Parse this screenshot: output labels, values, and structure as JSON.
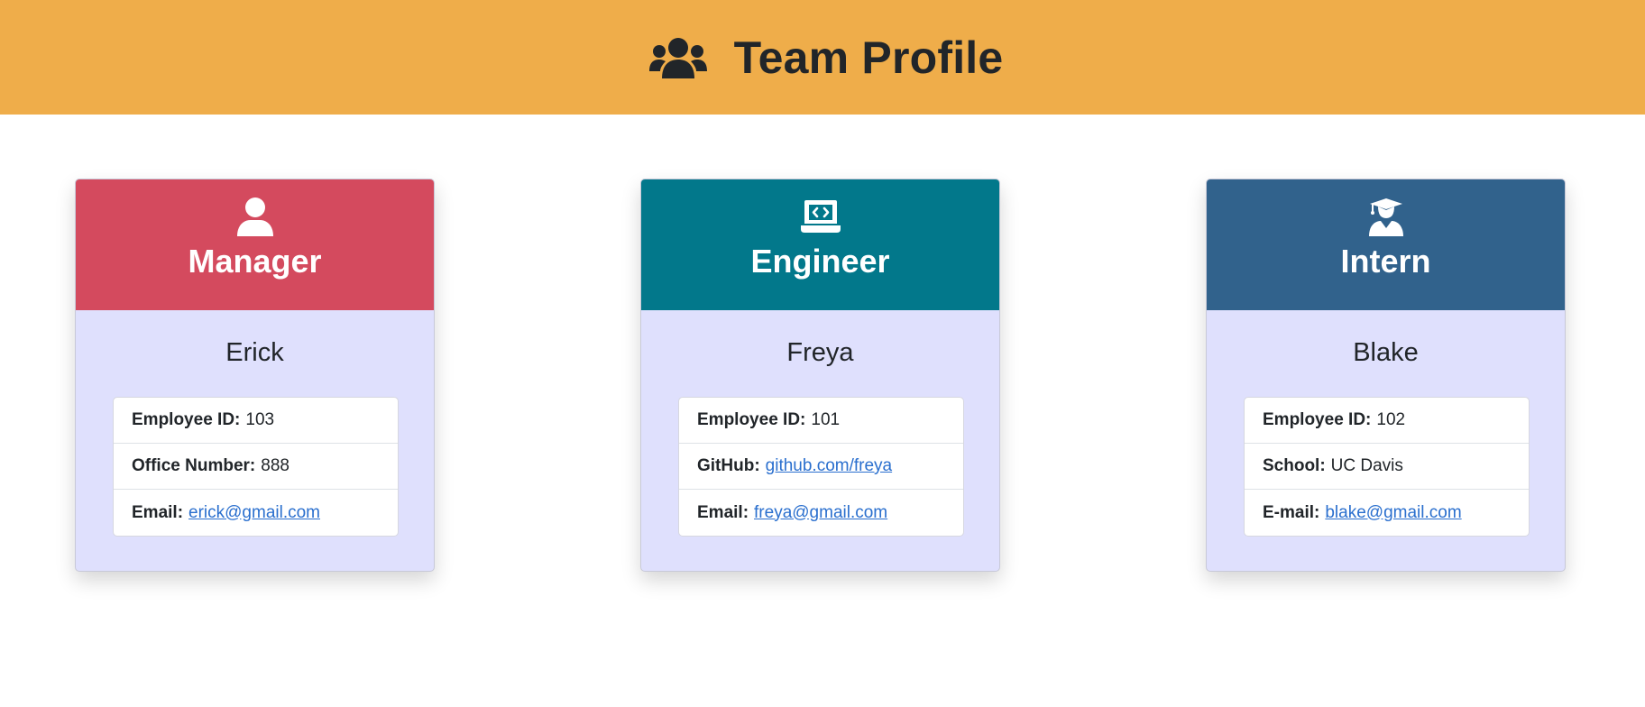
{
  "header": {
    "title": "Team Profile",
    "icon": "users-icon",
    "background": "#efad4a"
  },
  "team": [
    {
      "role": "Manager",
      "icon": "user-icon",
      "color": "#d44a5e",
      "name": "Erick",
      "details": [
        {
          "label": "Employee ID:",
          "value": "103"
        },
        {
          "label": "Office Number:",
          "value": "888"
        },
        {
          "label": "Email:",
          "value": "erick@gmail.com"
        }
      ]
    },
    {
      "role": "Engineer",
      "icon": "laptop-code-icon",
      "color": "#02788b",
      "name": "Freya",
      "details": [
        {
          "label": "Employee ID:",
          "value": "101"
        },
        {
          "label": "GitHub:",
          "value": "github.com/freya"
        },
        {
          "label": "Email:",
          "value": "freya@gmail.com"
        }
      ]
    },
    {
      "role": "Intern",
      "icon": "user-graduate-icon",
      "color": "#31628c",
      "name": "Blake",
      "details": [
        {
          "label": "Employee ID:",
          "value": "102"
        },
        {
          "label": "School:",
          "value": "UC Davis"
        },
        {
          "label": "E-mail:",
          "value": "blake@gmail.com"
        }
      ]
    }
  ]
}
